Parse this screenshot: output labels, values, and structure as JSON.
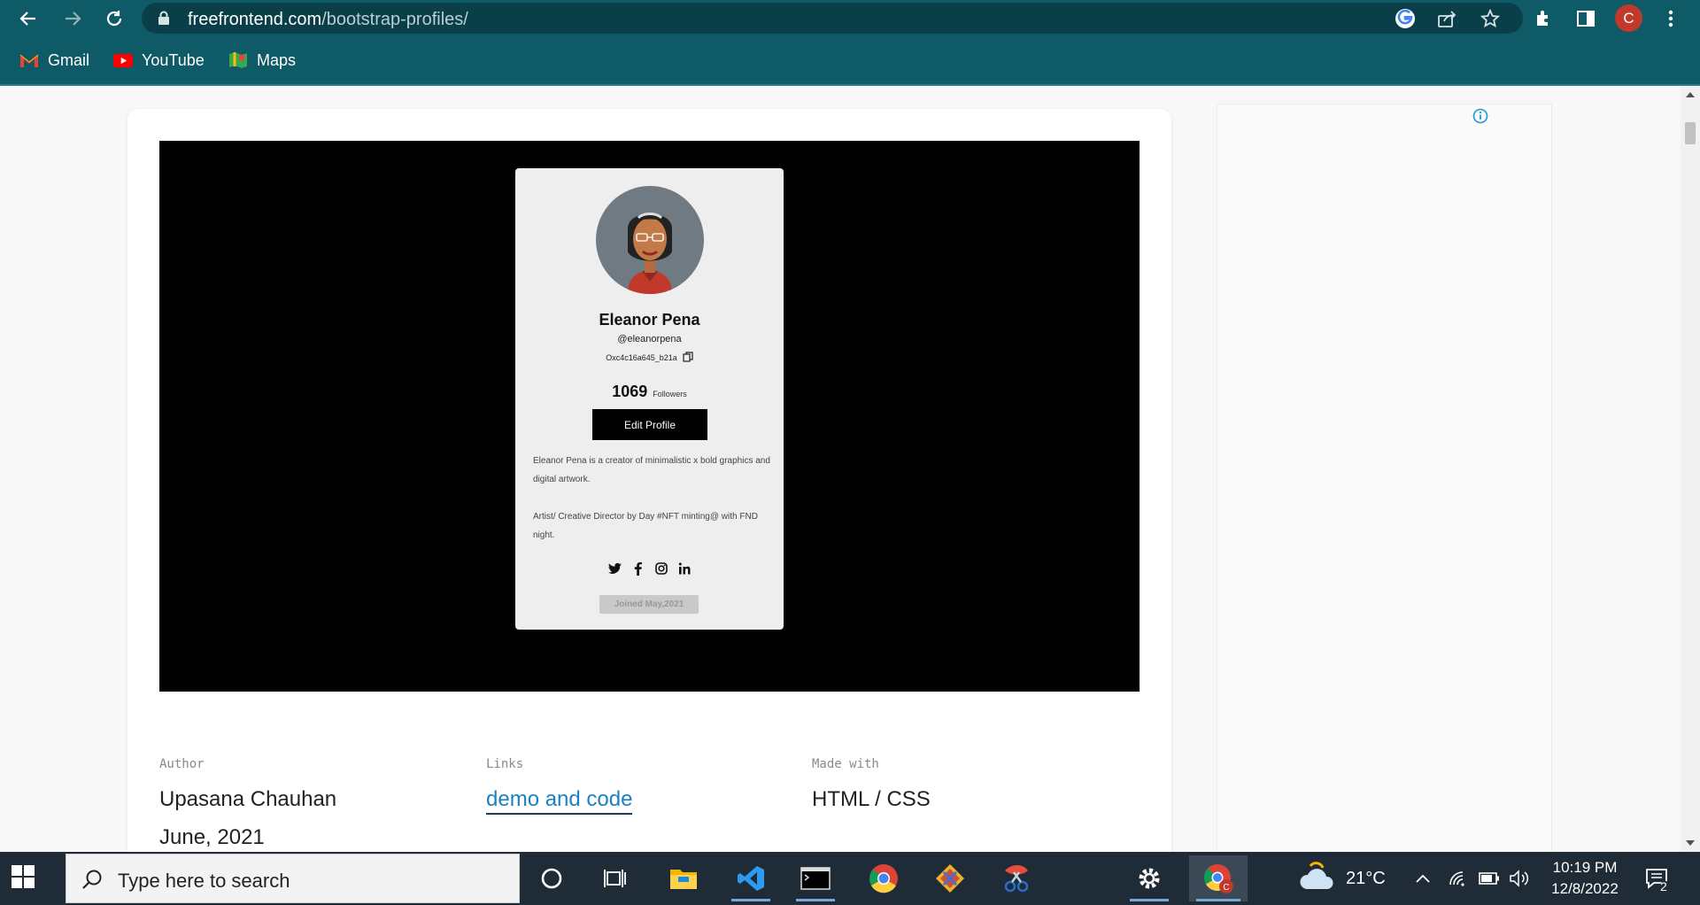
{
  "browser": {
    "url_domain": "freefrontend.com",
    "url_path": "/bootstrap-profiles/",
    "profile_initial": "C",
    "bookmarks": [
      {
        "label": "Gmail",
        "icon": "gmail-icon"
      },
      {
        "label": "YouTube",
        "icon": "youtube-icon"
      },
      {
        "label": "Maps",
        "icon": "maps-icon"
      }
    ]
  },
  "profile_card": {
    "name": "Eleanor Pena",
    "handle": "@eleanorpena",
    "wallet": "Oxc4c16a645_b21a",
    "followers_count": "1069",
    "followers_label": "Followers",
    "edit_button": "Edit Profile",
    "bio_line1": "Eleanor Pena is a creator of minimalistic x bold graphics and digital artwork.",
    "bio_line2": "Artist/ Creative Director by Day #NFT minting@ with FND night.",
    "joined": "Joined May,2021",
    "social": [
      "twitter-icon",
      "facebook-icon",
      "instagram-icon",
      "linkedin-icon"
    ]
  },
  "meta": {
    "author_label": "Author",
    "author_name": "Upasana Chauhan",
    "author_date": "June, 2021",
    "links_label": "Links",
    "links_value": "demo and code",
    "made_with_label": "Made with",
    "made_with_value": "HTML / CSS"
  },
  "taskbar": {
    "search_placeholder": "Type here to search",
    "temperature": "21°C",
    "time": "10:19 PM",
    "date": "12/8/2022",
    "notification_count": "2"
  },
  "colors": {
    "chrome": "#0e5a66",
    "link": "#1a82c4",
    "taskbar": "#1f2b36"
  }
}
